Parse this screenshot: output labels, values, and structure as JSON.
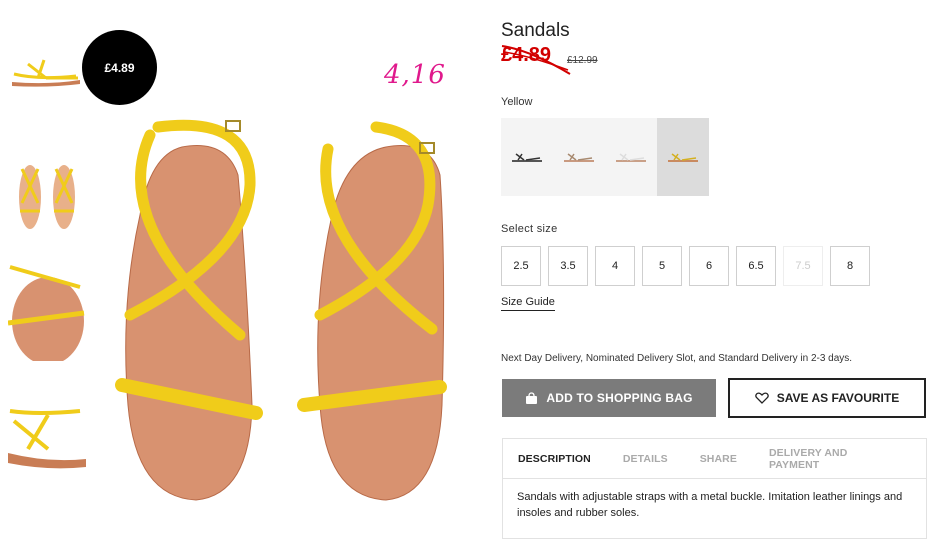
{
  "product": {
    "title": "Sandals",
    "sale_price": "£4.89",
    "old_price": "£12.99",
    "badge_price": "£4.89",
    "annotation": "4,16",
    "color_label": "Yellow",
    "accent_sale": "#d20000",
    "accent_annotation": "#e0198c",
    "strap_color": "#f0cc1a"
  },
  "sizes": {
    "label": "Select size",
    "options": [
      "2.5",
      "3.5",
      "4",
      "5",
      "6",
      "6.5",
      "7.5",
      "8"
    ],
    "unavailable": [
      "7.5"
    ],
    "guide_label": "Size Guide"
  },
  "delivery_note": "Next Day Delivery, Nominated Delivery Slot, and Standard Delivery in 2-3 days.",
  "actions": {
    "add_to_bag": "ADD TO SHOPPING BAG",
    "save_favourite": "SAVE AS FAVOURITE"
  },
  "tabs": [
    "DESCRIPTION",
    "DETAILS",
    "SHARE",
    "DELIVERY AND PAYMENT"
  ],
  "description_text": "Sandals with adjustable straps with a metal buckle. Imitation leather linings and insoles and rubber soles.",
  "icons": {
    "bag": "shopping-bag-icon",
    "heart": "heart-icon"
  }
}
